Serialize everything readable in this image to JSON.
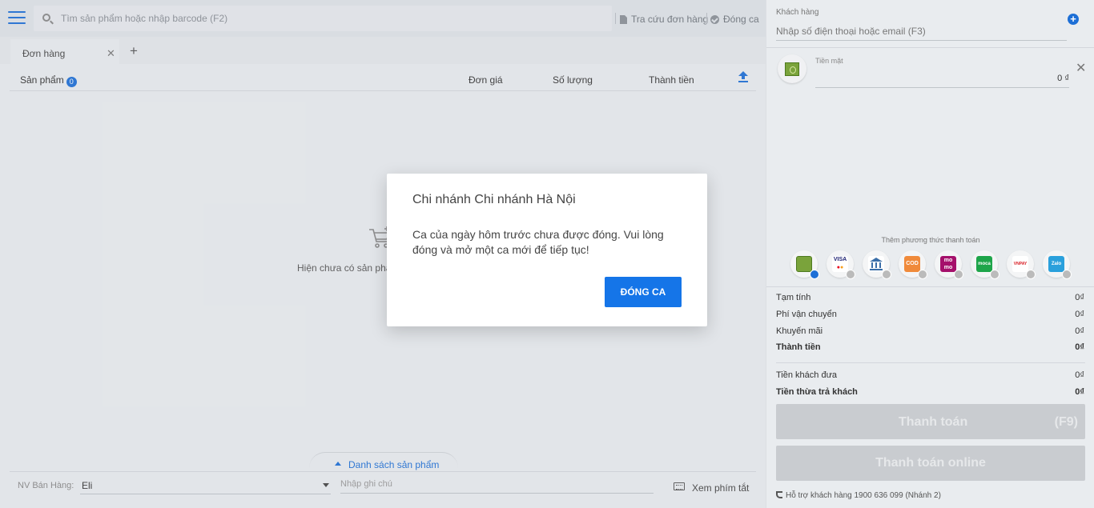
{
  "header": {
    "search_placeholder": "Tìm sản phẩm hoặc nhập barcode (F2)",
    "lookup_label": "Tra cứu đơn hàng",
    "close_shift_label": "Đóng ca"
  },
  "tabs": [
    {
      "label": "Đơn hàng"
    }
  ],
  "table": {
    "col_product": "Sản phẩm",
    "product_count": "0",
    "col_price": "Đơn giá",
    "col_qty": "Số lượng",
    "col_total": "Thành tiền"
  },
  "empty_message": "Hiện chưa có sản phẩm",
  "product_list_toggle": "Danh sách sản phẩm",
  "footer": {
    "staff_label": "NV Bán Hàng:",
    "staff_value": "Eli",
    "note_placeholder": "Nhập ghi chú",
    "shortcuts_label": "Xem phím tắt"
  },
  "customer": {
    "label": "Khách hàng",
    "placeholder": "Nhập số điện thoại hoặc email (F3)"
  },
  "payment": {
    "method_label": "Tiền mặt",
    "amount": "0 ₫",
    "add_method_label": "Thêm phương thức thanh toán",
    "methods": [
      {
        "name": "cash",
        "icon": "cash-icon",
        "color": "#7aa33b",
        "text": "",
        "selected": true
      },
      {
        "name": "visa",
        "icon": "visa-icon",
        "color": "#ffffff",
        "text": "VISA",
        "selected": false
      },
      {
        "name": "bank",
        "icon": "bank-icon",
        "color": "#ffffff",
        "text": "",
        "selected": false
      },
      {
        "name": "cod",
        "icon": "cod-icon",
        "color": "#f08a3a",
        "text": "COD",
        "selected": false
      },
      {
        "name": "momo",
        "icon": "momo-icon",
        "color": "#a5106b",
        "text": "mo mo",
        "selected": false
      },
      {
        "name": "moca",
        "icon": "moca-icon",
        "color": "#1ea54a",
        "text": "moca",
        "selected": false
      },
      {
        "name": "vnpay",
        "icon": "vnpay-icon",
        "color": "#ffffff",
        "text": "VNPAY",
        "selected": false
      },
      {
        "name": "zalopay",
        "icon": "zalopay-icon",
        "color": "#2aa0dc",
        "text": "Zalo",
        "selected": false
      }
    ]
  },
  "summary": {
    "subtotal_label": "Tạm tính",
    "subtotal": "0₫",
    "shipping_label": "Phí vận chuyển",
    "shipping": "0₫",
    "discount_label": "Khuyến mãi",
    "discount": "0₫",
    "total_label": "Thành tiền",
    "total": "0₫",
    "paid_label": "Tiền khách đưa",
    "paid": "0₫",
    "change_label": "Tiền thừa trả khách",
    "change": "0₫"
  },
  "actions": {
    "pay_label": "Thanh toán",
    "pay_shortcut": "(F9)",
    "pay_online_label": "Thanh toán online"
  },
  "support_text": "Hỗ trợ khách hàng 1900 636 099 (Nhánh 2)",
  "modal": {
    "title": "Chi nhánh Chi nhánh Hà Nội",
    "message": "Ca của ngày hôm trước chưa được đóng. Vui lòng đóng và mở một ca mới để tiếp tục!",
    "button_label": "ĐÓNG CA"
  }
}
